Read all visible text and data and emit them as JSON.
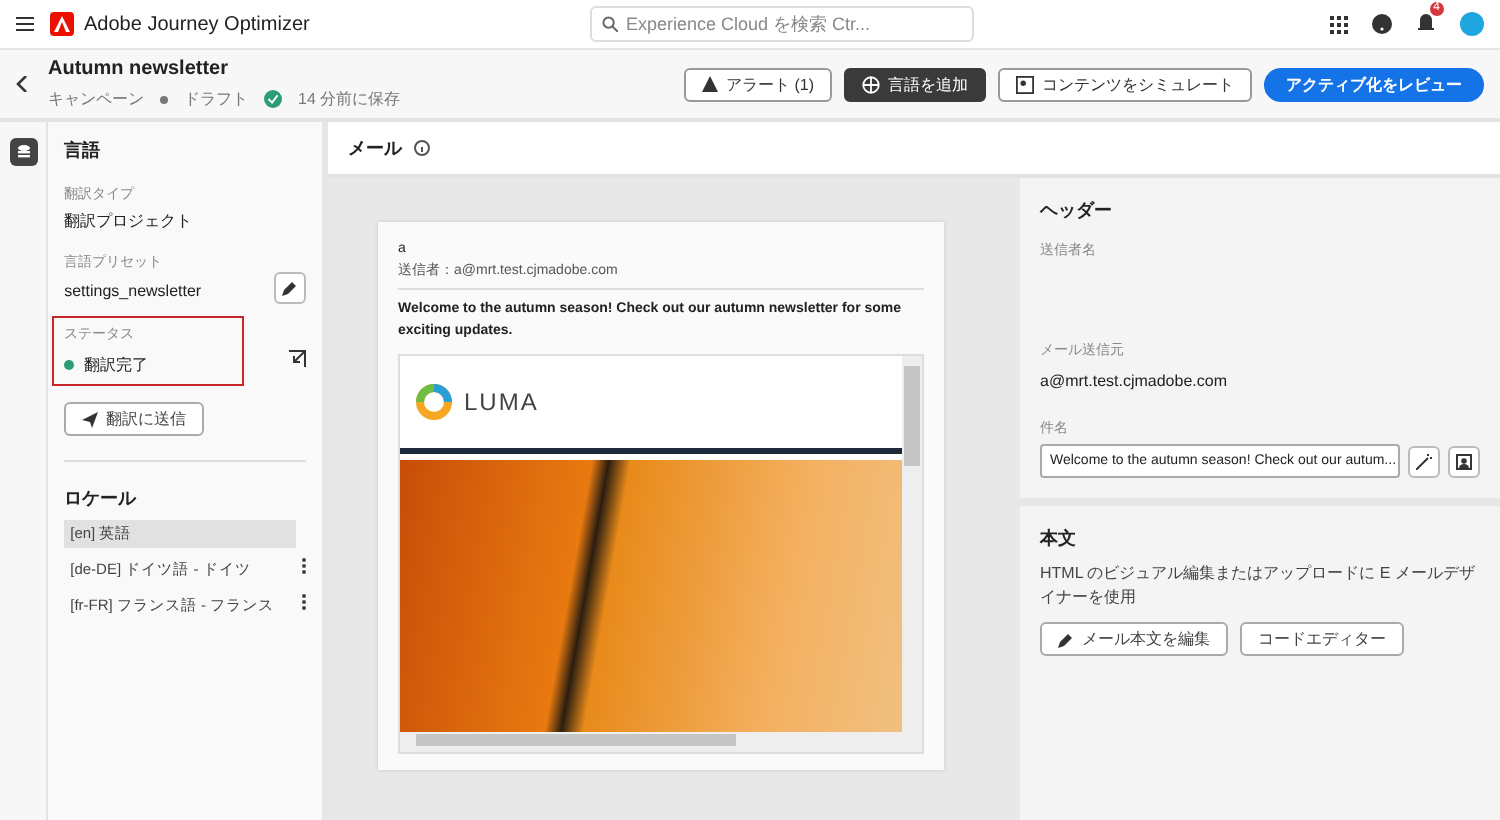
{
  "app_bar": {
    "product": "Adobe Journey Optimizer",
    "search_placeholder": "Experience Cloud を検索 Ctr...",
    "notification_count": "4"
  },
  "page_header": {
    "title": "Autumn newsletter",
    "type": "キャンペーン",
    "state": "ドラフト",
    "saved": "14 分前に保存",
    "buttons": [
      {
        "kind": "alert",
        "label": "アラート (1)"
      },
      {
        "kind": "dark",
        "label": "言語を追加"
      },
      {
        "kind": "simulate",
        "label": "コンテンツをシミュレート"
      },
      {
        "kind": "primary",
        "label": "アクティブ化をレビュー"
      }
    ]
  },
  "language_panel": {
    "title": "言語",
    "translation_type_label": "翻訳タイプ",
    "translation_type": "翻訳プロジェクト",
    "preset_label": "言語プリセット",
    "preset": "settings_newsletter",
    "status_label": "ステータス",
    "status": "翻訳完了",
    "send_button": "翻訳に送信",
    "locales_title": "ロケール",
    "locales": [
      {
        "label": "[en] 英語",
        "selected": true
      },
      {
        "label": "[de-DE] ドイツ語 - ドイツ",
        "selected": false
      },
      {
        "label": "[fr-FR] フランス語 - フランス",
        "selected": false
      }
    ]
  },
  "email": {
    "title": "メール",
    "preview": {
      "sender": "a",
      "from": "送信者：a@mrt.test.cjmadobe.com",
      "subject": "Welcome to the autumn season! Check out our autumn newsletter for some exciting updates.",
      "logo_text": "LUMA"
    }
  },
  "settings": {
    "header_title": "ヘッダー",
    "sender_name_label": "送信者名",
    "from_label": "メール送信元",
    "from": "a@mrt.test.cjmadobe.com",
    "subject_label": "件名",
    "subject": "Welcome to the autumn season! Check out our autum...",
    "body_title": "本文",
    "body_desc": "HTML のビジュアル編集またはアップロードに E メールデザイナーを使用",
    "edit_button": "メール本文を編集",
    "code_button": "コードエディター"
  }
}
